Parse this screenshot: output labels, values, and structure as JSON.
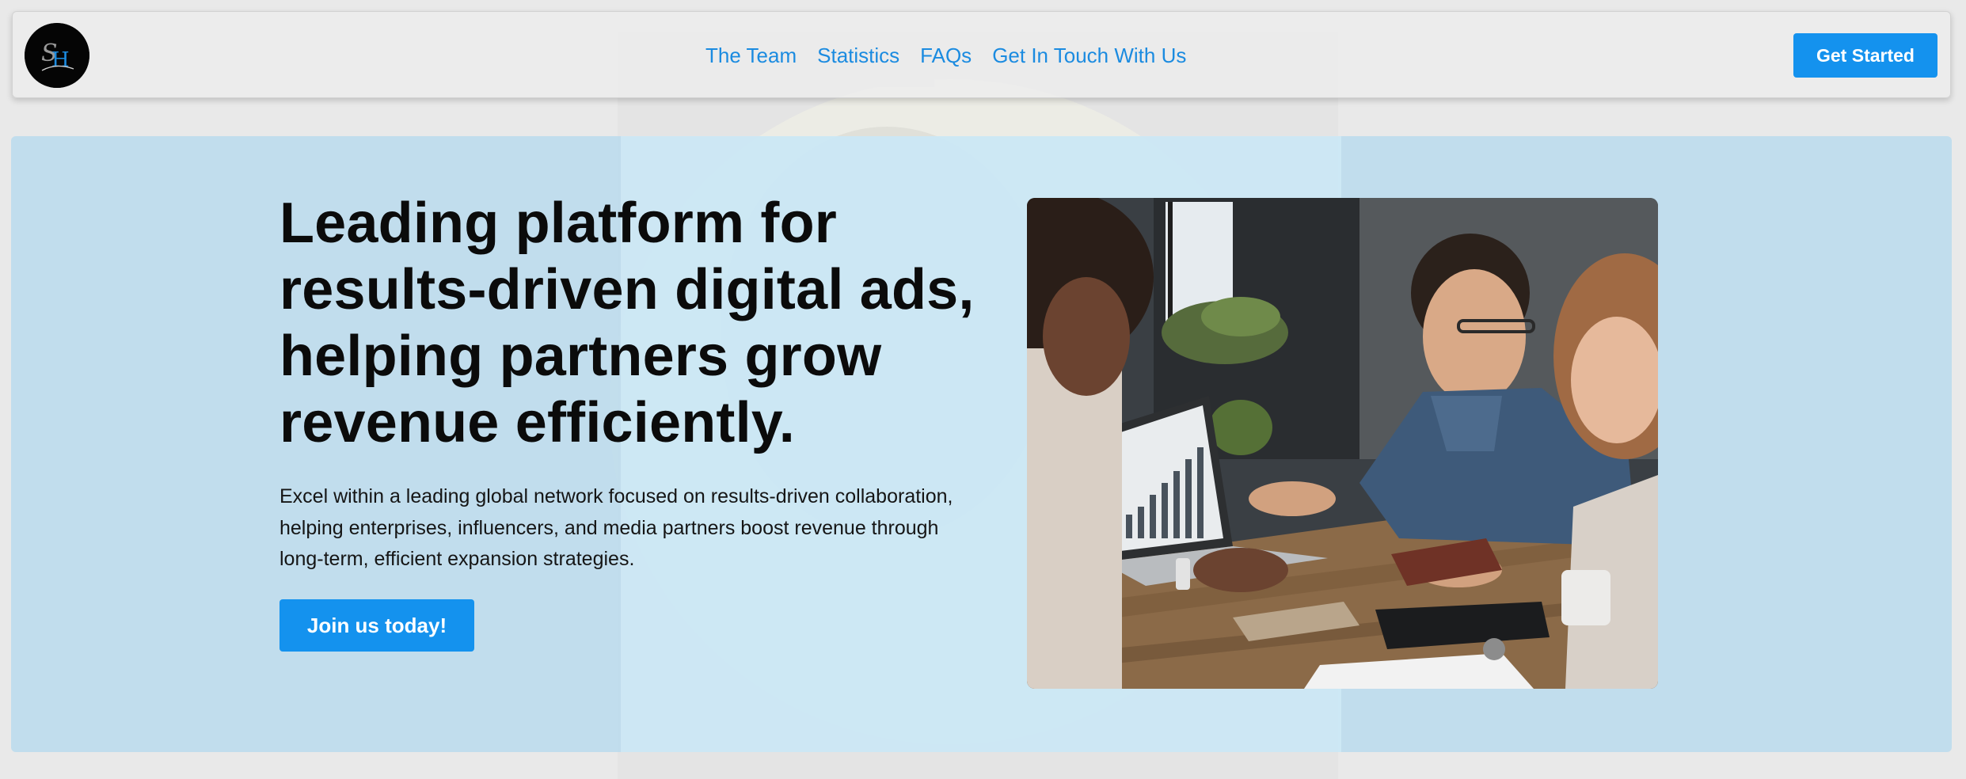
{
  "nav": {
    "logo_text": "SH",
    "links": [
      "The Team",
      "Statistics",
      "FAQs",
      "Get In Touch With Us"
    ],
    "cta_label": "Get Started"
  },
  "hero": {
    "heading_lines": [
      "Leading platform for",
      "results-driven digital ads,",
      "helping partners grow",
      "revenue efficiently."
    ],
    "subtext": "Excel within a leading global network focused on results-driven collaboration, helping enterprises, influencers, and media partners boost revenue through long-term, efficient expansion strategies.",
    "button_label": "Join us today!",
    "image_icon": "team-meeting-photo"
  },
  "colors": {
    "accent": "#1492ee",
    "link": "#1b8be0",
    "hero_bg": "#b7daee",
    "page_bg": "#e9e9e9"
  }
}
